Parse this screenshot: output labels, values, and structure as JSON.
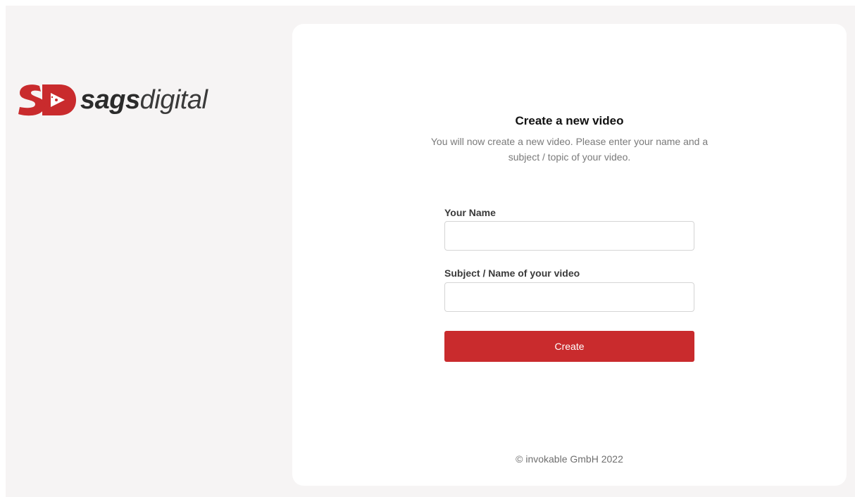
{
  "brand": {
    "name_bold": "sags",
    "name_light": "digital",
    "mark_letters": "SD",
    "accent_color": "#c92b2d"
  },
  "form": {
    "title": "Create a new video",
    "subtitle": "You will now create a new video. Please enter your name and a subject / topic of your video.",
    "name_label": "Your Name",
    "name_value": "",
    "subject_label": "Subject / Name of your video",
    "subject_value": "",
    "create_label": "Create"
  },
  "footer": {
    "copyright": "© invokable GmbH 2022"
  }
}
